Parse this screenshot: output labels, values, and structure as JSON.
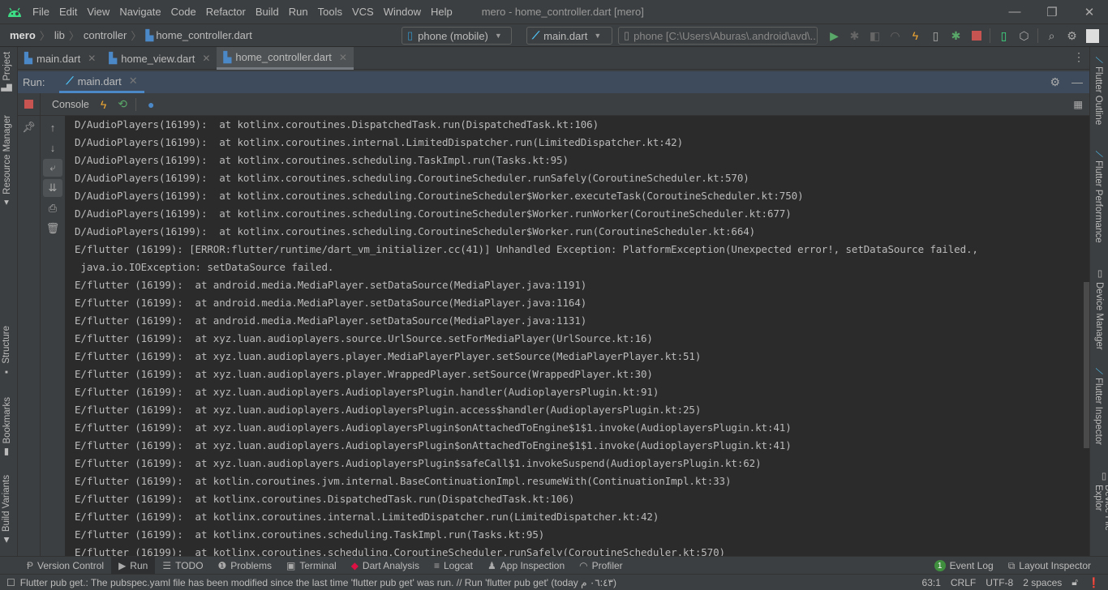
{
  "window": {
    "title": "mero - home_controller.dart [mero]",
    "menu": [
      "File",
      "Edit",
      "View",
      "Navigate",
      "Code",
      "Refactor",
      "Build",
      "Run",
      "Tools",
      "VCS",
      "Window",
      "Help"
    ]
  },
  "breadcrumb": {
    "project": "mero",
    "items": [
      "lib",
      "controller"
    ],
    "file": "home_controller.dart"
  },
  "toolbar": {
    "device_selector": "phone (mobile)",
    "run_config": "main.dart",
    "emulator": "phone [C:\\Users\\Aburas\\.android\\avd\\..."
  },
  "editor_tabs": [
    {
      "label": "main.dart",
      "active": false
    },
    {
      "label": "home_view.dart",
      "active": false
    },
    {
      "label": "home_controller.dart",
      "active": true
    }
  ],
  "left_strip": [
    "Project",
    "Resource Manager",
    "Structure",
    "Bookmarks",
    "Build Variants"
  ],
  "right_strip": [
    "Flutter Outline",
    "Flutter Performance",
    "Device Manager",
    "Flutter Inspector",
    "Device File Explor"
  ],
  "run_panel": {
    "label": "Run:",
    "tab": "main.dart",
    "console_label": "Console"
  },
  "console_lines": [
    "D/AudioPlayers(16199):  at kotlinx.coroutines.DispatchedTask.run(DispatchedTask.kt:106)",
    "D/AudioPlayers(16199):  at kotlinx.coroutines.internal.LimitedDispatcher.run(LimitedDispatcher.kt:42)",
    "D/AudioPlayers(16199):  at kotlinx.coroutines.scheduling.TaskImpl.run(Tasks.kt:95)",
    "D/AudioPlayers(16199):  at kotlinx.coroutines.scheduling.CoroutineScheduler.runSafely(CoroutineScheduler.kt:570)",
    "D/AudioPlayers(16199):  at kotlinx.coroutines.scheduling.CoroutineScheduler$Worker.executeTask(CoroutineScheduler.kt:750)",
    "D/AudioPlayers(16199):  at kotlinx.coroutines.scheduling.CoroutineScheduler$Worker.runWorker(CoroutineScheduler.kt:677)",
    "D/AudioPlayers(16199):  at kotlinx.coroutines.scheduling.CoroutineScheduler$Worker.run(CoroutineScheduler.kt:664)",
    "E/flutter (16199): [ERROR:flutter/runtime/dart_vm_initializer.cc(41)] Unhandled Exception: PlatformException(Unexpected error!, setDataSource failed.,",
    " java.io.IOException: setDataSource failed.",
    "E/flutter (16199):  at android.media.MediaPlayer.setDataSource(MediaPlayer.java:1191)",
    "E/flutter (16199):  at android.media.MediaPlayer.setDataSource(MediaPlayer.java:1164)",
    "E/flutter (16199):  at android.media.MediaPlayer.setDataSource(MediaPlayer.java:1131)",
    "E/flutter (16199):  at xyz.luan.audioplayers.source.UrlSource.setForMediaPlayer(UrlSource.kt:16)",
    "E/flutter (16199):  at xyz.luan.audioplayers.player.MediaPlayerPlayer.setSource(MediaPlayerPlayer.kt:51)",
    "E/flutter (16199):  at xyz.luan.audioplayers.player.WrappedPlayer.setSource(WrappedPlayer.kt:30)",
    "E/flutter (16199):  at xyz.luan.audioplayers.AudioplayersPlugin.handler(AudioplayersPlugin.kt:91)",
    "E/flutter (16199):  at xyz.luan.audioplayers.AudioplayersPlugin.access$handler(AudioplayersPlugin.kt:25)",
    "E/flutter (16199):  at xyz.luan.audioplayers.AudioplayersPlugin$onAttachedToEngine$1$1.invoke(AudioplayersPlugin.kt:41)",
    "E/flutter (16199):  at xyz.luan.audioplayers.AudioplayersPlugin$onAttachedToEngine$1$1.invoke(AudioplayersPlugin.kt:41)",
    "E/flutter (16199):  at xyz.luan.audioplayers.AudioplayersPlugin$safeCall$1.invokeSuspend(AudioplayersPlugin.kt:62)",
    "E/flutter (16199):  at kotlin.coroutines.jvm.internal.BaseContinuationImpl.resumeWith(ContinuationImpl.kt:33)",
    "E/flutter (16199):  at kotlinx.coroutines.DispatchedTask.run(DispatchedTask.kt:106)",
    "E/flutter (16199):  at kotlinx.coroutines.internal.LimitedDispatcher.run(LimitedDispatcher.kt:42)",
    "E/flutter (16199):  at kotlinx.coroutines.scheduling.TaskImpl.run(Tasks.kt:95)",
    "E/flutter (16199):  at kotlinx.coroutines.scheduling.CoroutineScheduler.runSafely(CoroutineScheduler.kt:570)"
  ],
  "bottom_tabs": [
    {
      "label": "Version Control",
      "icon": "version-control-icon"
    },
    {
      "label": "Run",
      "icon": "run-icon",
      "active": true
    },
    {
      "label": "TODO",
      "icon": "todo-icon"
    },
    {
      "label": "Problems",
      "icon": "problems-icon"
    },
    {
      "label": "Terminal",
      "icon": "terminal-icon"
    },
    {
      "label": "Dart Analysis",
      "icon": "dart-analysis-icon"
    },
    {
      "label": "Logcat",
      "icon": "logcat-icon"
    },
    {
      "label": "App Inspection",
      "icon": "app-inspection-icon"
    },
    {
      "label": "Profiler",
      "icon": "profiler-icon"
    }
  ],
  "bottom_right": {
    "event_log": "Event Log",
    "event_count": "1",
    "layout_inspector": "Layout Inspector"
  },
  "status": {
    "message": "Flutter pub get.: The pubspec.yaml file has been modified since the last time 'flutter pub get' was run. // Run 'flutter pub get' (today ٠٦:٤٣ م)",
    "position": "63:1",
    "line_sep": "CRLF",
    "encoding": "UTF-8",
    "indent": "2 spaces"
  }
}
